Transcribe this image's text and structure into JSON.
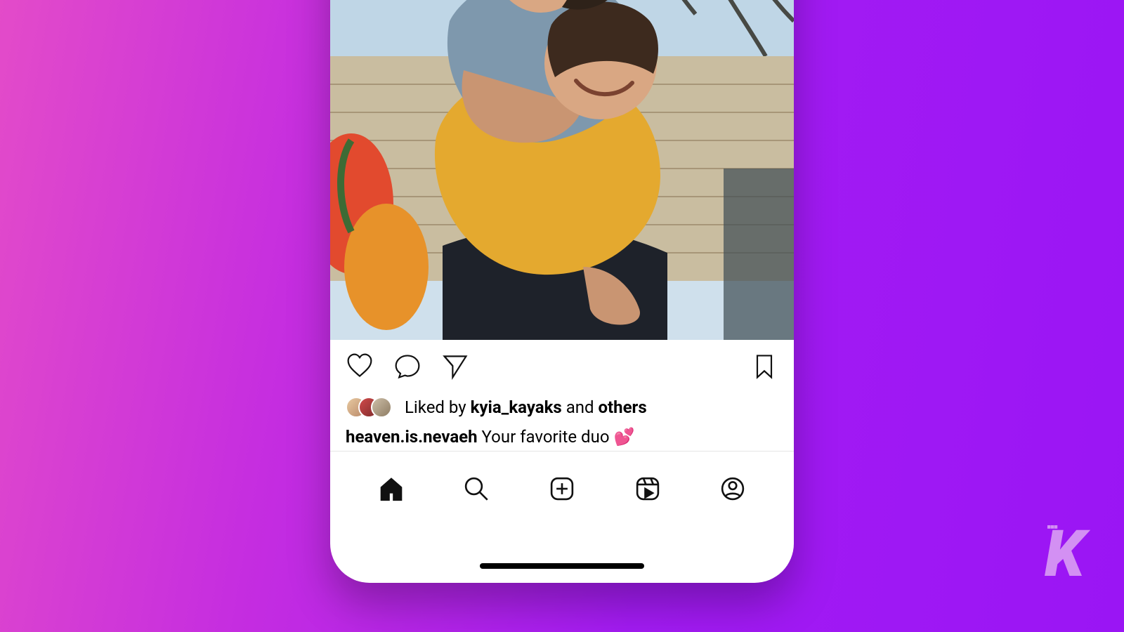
{
  "post": {
    "image_alt": "Two friends outdoors, one giving the other a piggyback ride, both laughing",
    "liked_by_prefix": "Liked by",
    "liked_by_user": "kyia_kayaks",
    "liked_by_middle": "and",
    "liked_by_suffix": "others",
    "caption_user": "heaven.is.nevaeh",
    "caption_text": "Your favorite duo",
    "caption_emoji": "💕",
    "actions": {
      "like": "heart-icon",
      "comment": "comment-icon",
      "share": "send-icon",
      "save": "bookmark-icon"
    }
  },
  "nav": {
    "home": "home-icon",
    "search": "search-icon",
    "create": "plus-square-icon",
    "reels": "reels-icon",
    "profile": "profile-icon"
  },
  "watermark": {
    "letter": "K",
    "dots": "∙∙∙"
  },
  "colors": {
    "bg_from": "#e34bc9",
    "bg_to": "#9a15f4",
    "ink": "#111111",
    "phone_bg": "#ffffff"
  }
}
